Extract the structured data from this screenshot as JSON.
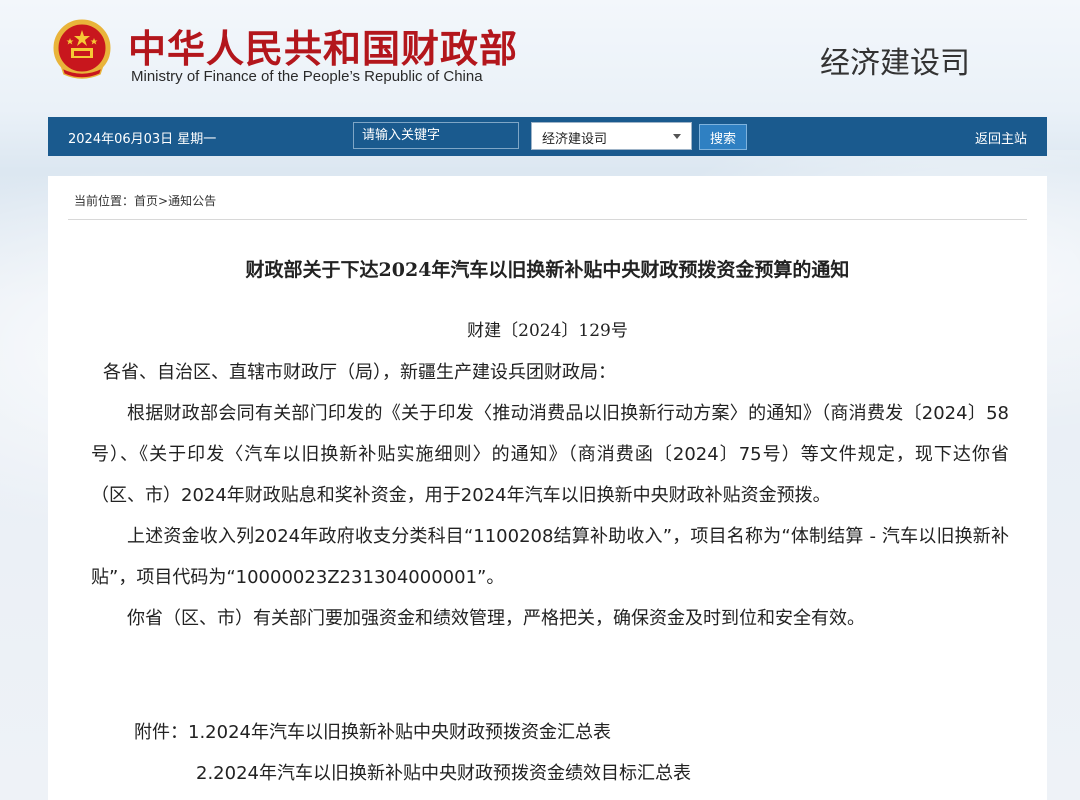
{
  "header": {
    "title_cn": "中华人民共和国财政部",
    "title_en": "Ministry of Finance of the People’s Republic of China",
    "department": "经济建设司"
  },
  "navbar": {
    "date": "2024年06月03日  星期一",
    "search_placeholder": "请输入关键字",
    "channel_selected": "经济建设司",
    "search_button": "搜索",
    "home_link": "返回主站"
  },
  "breadcrumb": {
    "prefix": "当前位置：",
    "home": "首页",
    "sep": ">",
    "current": "通知公告"
  },
  "document": {
    "title": "财政部关于下达2024年汽车以旧换新补贴中央财政预拨资金预算的通知",
    "number": "财建〔2024〕129号",
    "addressee": "各省、自治区、直辖市财政厅（局），新疆生产建设兵团财政局：",
    "paragraphs": [
      "根据财政部会同有关部门印发的《关于印发〈推动消费品以旧换新行动方案〉的通知》（商消费发〔2024〕58号）、《关于印发〈汽车以旧换新补贴实施细则〉的通知》（商消费函〔2024〕75号）等文件规定，现下达你省（区、市）2024年财政贴息和奖补资金，用于2024年汽车以旧换新中央财政补贴资金预拨。",
      "上述资金收入列2024年政府收支分类科目“1100208结算补助收入”，项目名称为“体制结算 - 汽车以旧换新补贴”，项目代码为“10000023Z231304000001”。",
      "你省（区、市）有关部门要加强资金和绩效管理，严格把关，确保资金及时到位和安全有效。"
    ],
    "attachments_label": "附件：",
    "attachments": [
      "1.2024年汽车以旧换新补贴中央财政预拨资金汇总表",
      "2.2024年汽车以旧换新补贴中央财政预拨资金绩效目标汇总表"
    ]
  },
  "colors": {
    "title_red": "#b3161c",
    "nav_blue": "#1a5a8e",
    "button_blue": "#2f80c2"
  }
}
